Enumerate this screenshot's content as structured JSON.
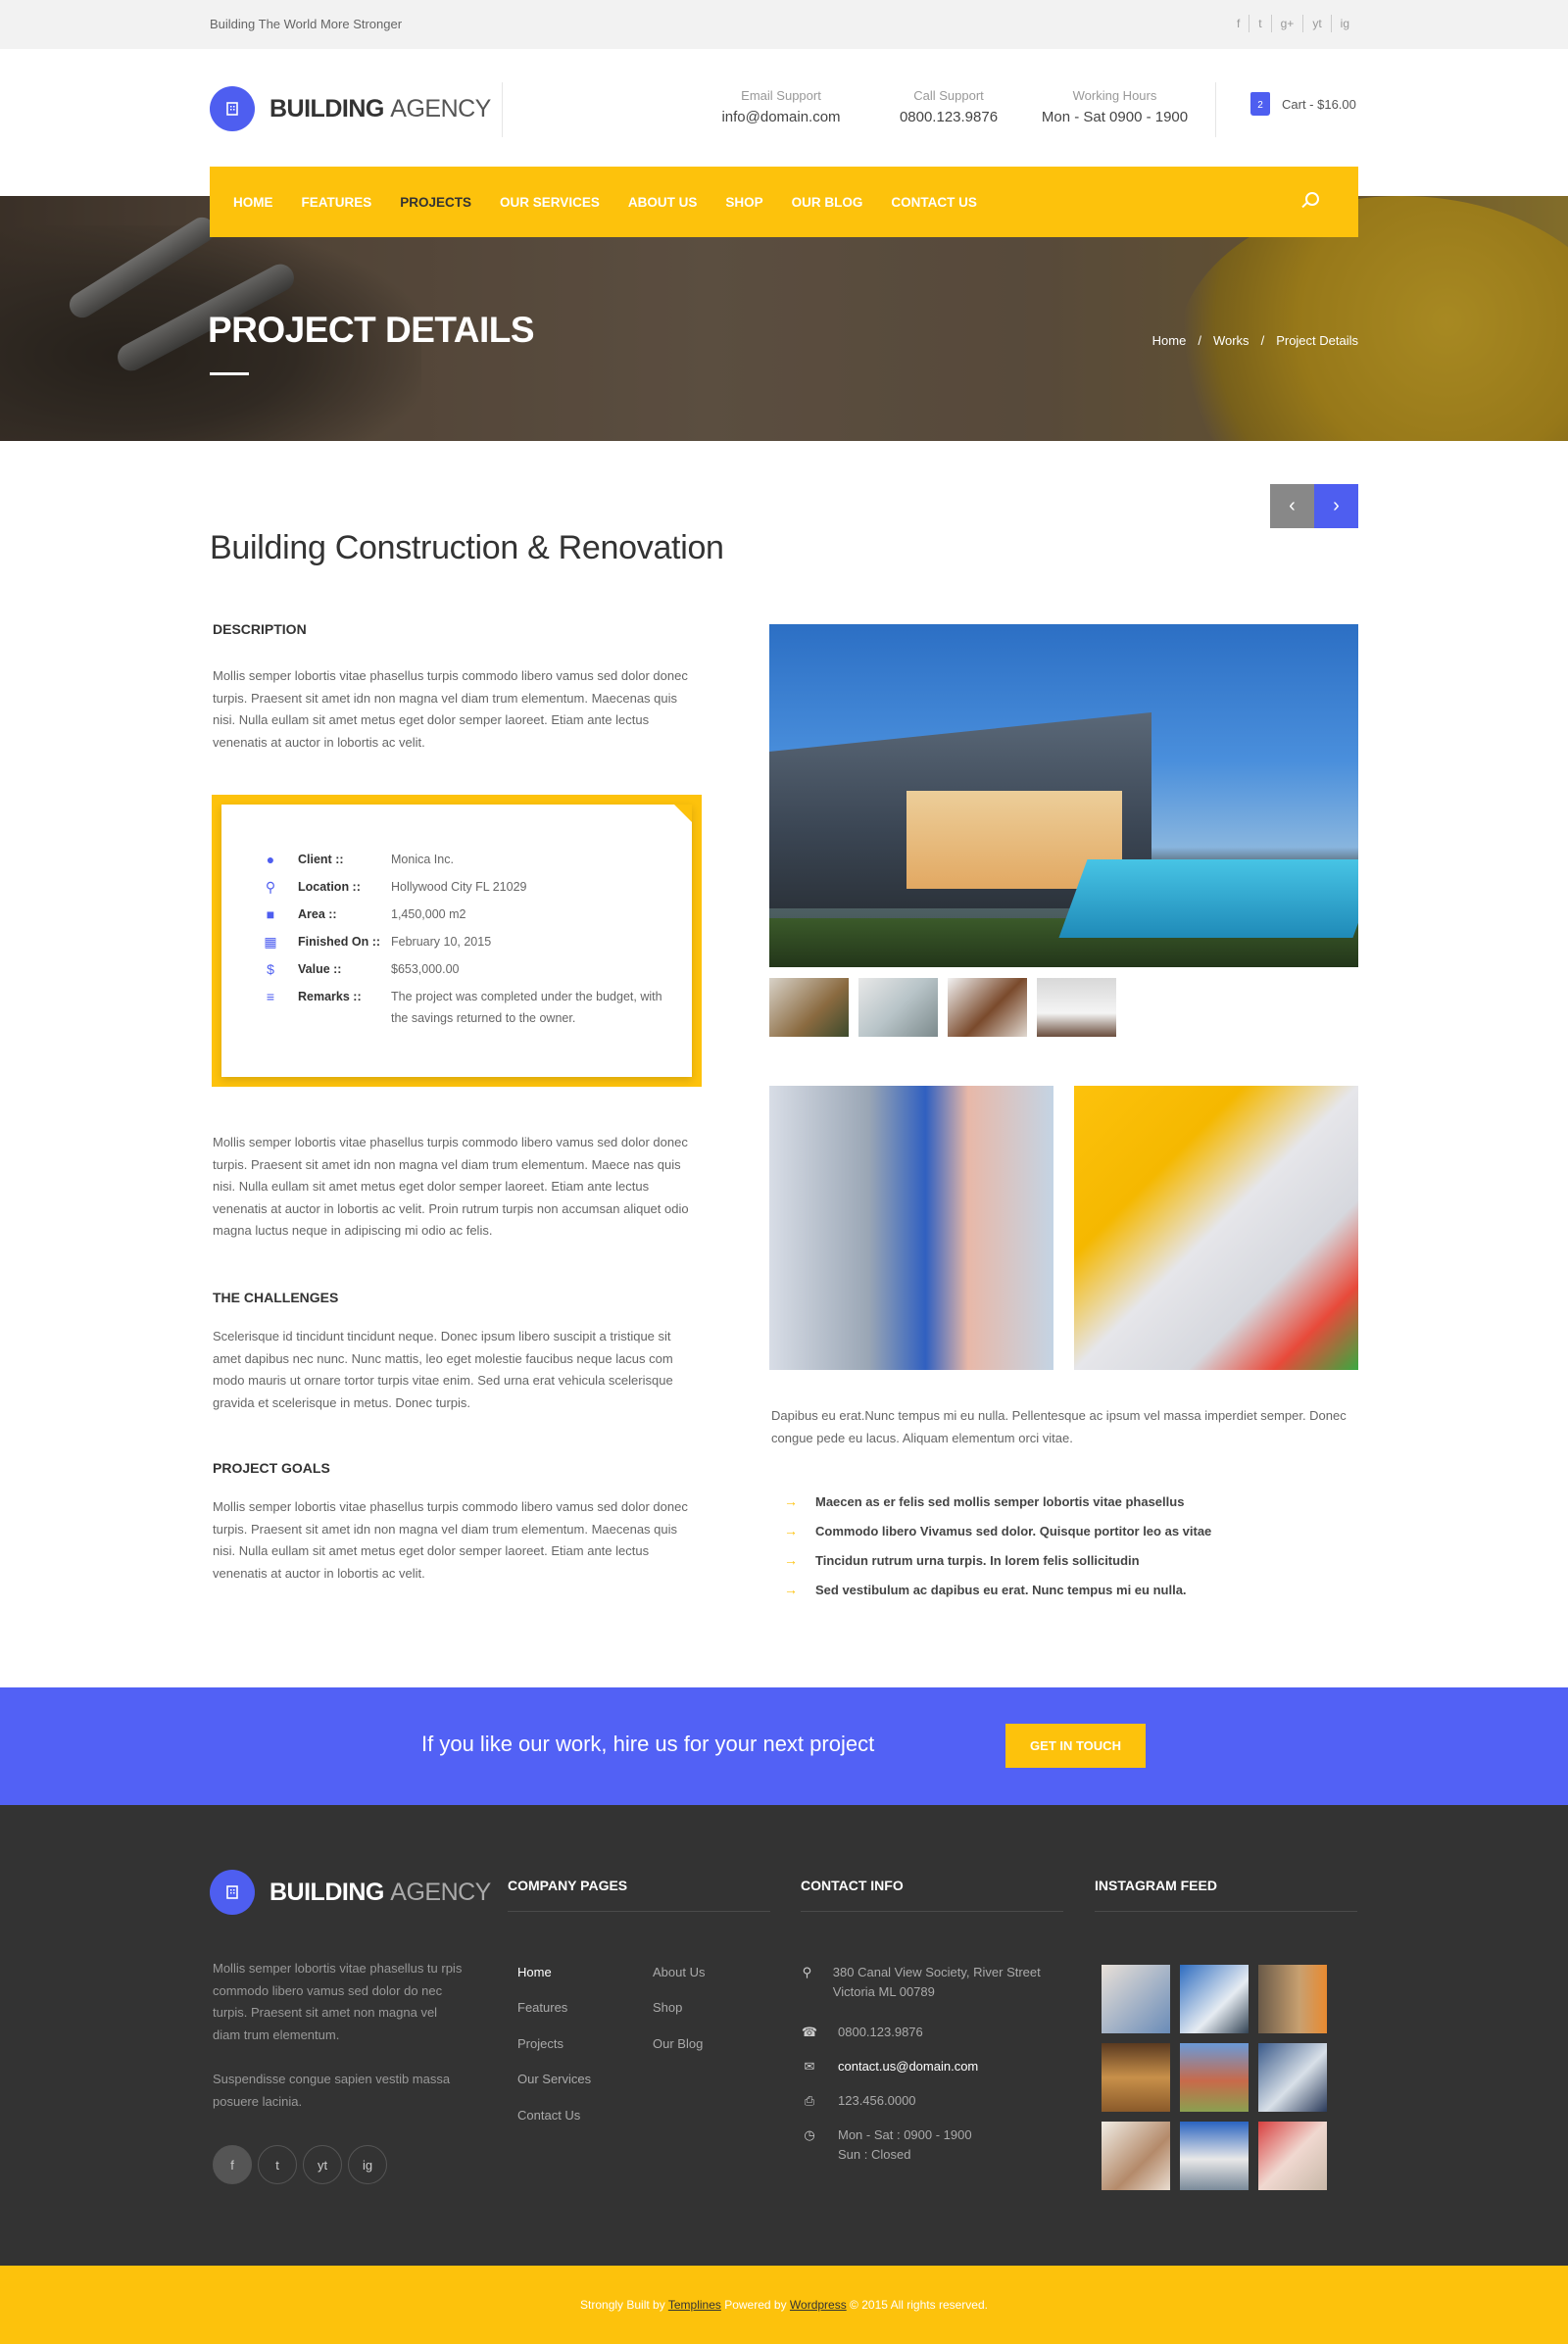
{
  "topbar": {
    "tagline": "Building The World More Stronger",
    "social": [
      "f",
      "t",
      "g+",
      "yt",
      "ig"
    ]
  },
  "brand": {
    "name_bold": "BUILDING",
    "name_light": "AGENCY",
    "icon": "building-icon"
  },
  "header": {
    "email": {
      "label": "Email Support",
      "value": "info@domain.com"
    },
    "call": {
      "label": "Call Support",
      "value": "0800.123.9876"
    },
    "hours": {
      "label": "Working Hours",
      "value": "Mon - Sat 0900 - 1900"
    },
    "cart": {
      "label": "Cart - $16.00",
      "count": "2"
    }
  },
  "nav": {
    "items": [
      "HOME",
      "FEATURES",
      "PROJECTS",
      "OUR SERVICES",
      "ABOUT US",
      "SHOP",
      "OUR BLOG",
      "CONTACT US"
    ],
    "active": "PROJECTS"
  },
  "banner": {
    "title": "PROJECT DETAILS",
    "breadcrumb": [
      "Home",
      "Works",
      "Project Details"
    ]
  },
  "pager": {
    "prev": "‹",
    "next": "›"
  },
  "project": {
    "title": "Building Construction & Renovation",
    "description_heading": "DESCRIPTION",
    "description": "Mollis semper lobortis vitae phasellus turpis commodo libero vamus sed dolor donec turpis. Praesent sit amet idn non magna vel diam trum elementum. Maecenas quis nisi. Nulla eullam sit amet metus eget dolor semper laoreet. Etiam ante lectus venenatis at auctor in lobortis ac velit.",
    "info": [
      {
        "icon": "user-icon",
        "key": "Client ::",
        "value": "Monica Inc."
      },
      {
        "icon": "location-icon",
        "key": "Location ::",
        "value": "Hollywood City FL 21029"
      },
      {
        "icon": "area-icon",
        "key": "Area ::",
        "value": "1,450,000 m2"
      },
      {
        "icon": "calendar-icon",
        "key": "Finished On ::",
        "value": "February 10, 2015"
      },
      {
        "icon": "dollar-icon",
        "key": "Value ::",
        "value": "$653,000.00"
      },
      {
        "icon": "note-icon",
        "key": "Remarks ::",
        "value": "The project was completed under the budget, with the savings returned to the owner."
      }
    ],
    "para2": "Mollis semper lobortis vitae phasellus turpis commodo libero vamus sed dolor donec turpis. Praesent sit amet idn non magna vel diam trum elementum. Maece nas quis nisi. Nulla eullam sit amet metus eget dolor semper laoreet. Etiam ante lectus venenatis at auctor in lobortis ac velit. Proin rutrum turpis non accumsan aliquet odio magna luctus neque in adipiscing mi odio ac felis.",
    "challenges_heading": "THE CHALLENGES",
    "challenges": "Scelerisque id tincidunt tincidunt neque. Donec ipsum libero suscipit a tristique sit amet dapibus nec nunc. Nunc mattis, leo eget molestie faucibus neque lacus com modo mauris ut ornare tortor turpis vitae enim.  Sed urna erat vehicula scelerisque gravida et scelerisque in metus. Donec turpis.",
    "goals_heading": "PROJECT GOALS",
    "goals": "Mollis semper lobortis vitae phasellus turpis commodo libero vamus sed dolor donec turpis. Praesent sit amet idn non magna vel diam trum elementum. Maecenas quis nisi. Nulla eullam sit amet metus eget dolor semper laoreet. Etiam ante lectus venenatis at auctor in lobortis ac velit.",
    "right_para": "Dapibus eu erat.Nunc tempus mi eu nulla. Pellentesque ac ipsum vel massa imperdiet semper. Donec congue pede eu lacus. Aliquam elementum orci vitae.",
    "bullets": [
      "Maecen as er felis sed mollis semper lobortis vitae phasellus",
      "Commodo libero Vivamus sed dolor. Quisque portitor leo as vitae",
      "Tincidun rutrum urna turpis.  In lorem felis sollicitudin",
      "Sed vestibulum ac dapibus eu erat. Nunc tempus mi eu nulla."
    ]
  },
  "cta": {
    "text": "If you like our work, hire us for your next project",
    "button": "GET IN TOUCH"
  },
  "footer": {
    "about": "Mollis semper lobortis vitae phasellus tu rpis commodo libero vamus sed dolor do nec turpis. Praesent sit amet non magna vel diam trum elementum.",
    "about2": "Suspendisse congue sapien vestib massa posuere lacinia.",
    "social": [
      "f",
      "t",
      "yt",
      "ig"
    ],
    "company_heading": "COMPANY PAGES",
    "pages_col1": [
      "Home",
      "Features",
      "Projects",
      "Our Services",
      "Contact Us"
    ],
    "pages_col2": [
      "About Us",
      "Shop",
      "Our Blog"
    ],
    "contact_heading": "CONTACT INFO",
    "address": "380 Canal View Society, River Street Victoria ML 00789",
    "phone": "0800.123.9876",
    "email": "contact.us@domain.com",
    "fax": "123.456.0000",
    "hours": "Mon - Sat : 0900 - 1900",
    "hours2": "Sun : Closed",
    "insta_heading": "INSTAGRAM FEED"
  },
  "copyright": {
    "pre": "Strongly Built by ",
    "link1": "Templines",
    "mid": " Powered by ",
    "link2": "Wordpress",
    "post": "   © 2015 All rights reserved."
  },
  "colors": {
    "accent": "#fdc20c",
    "brand": "#4e5ef0",
    "footer": "#333333"
  }
}
